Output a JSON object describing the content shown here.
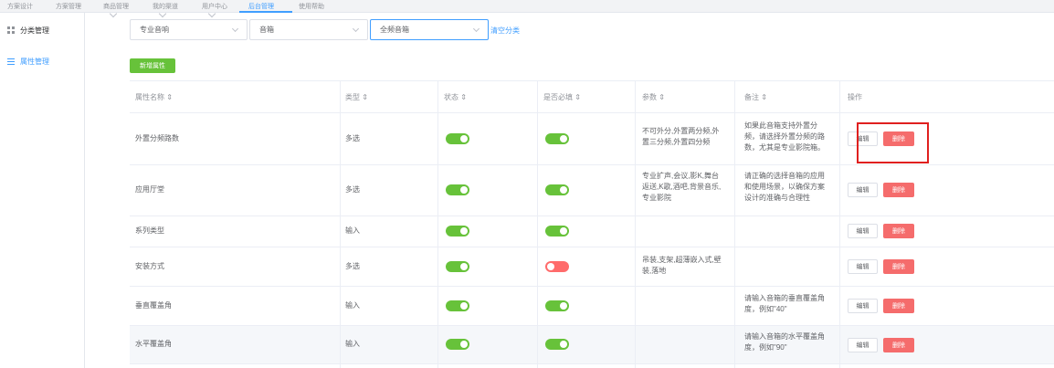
{
  "topnav": {
    "items": [
      "方案设计",
      "方案管理",
      "商品管理",
      "我的渠道",
      "用户中心",
      "后台管理",
      "使用帮助"
    ],
    "active_index": 5
  },
  "sidebar": {
    "items": [
      {
        "label": "分类管理",
        "icon": "grid-icon",
        "active": false
      },
      {
        "label": "属性管理",
        "icon": "list-icon",
        "active": true
      }
    ]
  },
  "filters": {
    "select1": "专业音响",
    "select2": "音箱",
    "select3": "全频音箱",
    "clear_label": "清空分类"
  },
  "add_button_label": "新增属性",
  "table": {
    "headers": [
      "属性名称 ⇕",
      "类型 ⇕",
      "状态 ⇕",
      "是否必填 ⇕",
      "参数 ⇕",
      "备注 ⇕",
      "操作"
    ],
    "rows": [
      {
        "name": "外置分频路数",
        "type": "多选",
        "status": true,
        "required": true,
        "params": [
          "不可外分,外置两分频,外",
          "置三分频,外置四分频"
        ],
        "note": [
          "如果此音箱支持外置分",
          "频，请选择外置分频的路",
          "数，尤其是专业影院箱。"
        ]
      },
      {
        "name": "应用厅堂",
        "type": "多选",
        "status": true,
        "required": true,
        "params": [
          "专业扩声,会议,影K,舞台",
          "返送,K歌,酒吧,背景音乐,",
          "专业影院"
        ],
        "note": [
          "请正确的选择音箱的应用",
          "和使用场景，以确保方案",
          "设计的准确与合理性"
        ]
      },
      {
        "name": "系列类型",
        "type": "输入",
        "status": true,
        "required": true,
        "params": [],
        "note": []
      },
      {
        "name": "安装方式",
        "type": "多选",
        "status": true,
        "required": false,
        "params": [
          "吊装,支架,超薄嵌入式,壁",
          "装,落地"
        ],
        "note": []
      },
      {
        "name": "垂直覆盖角",
        "type": "输入",
        "status": true,
        "required": true,
        "params": [],
        "note": [
          "请输入音箱的垂直覆盖角",
          "度，例如\"40\""
        ]
      },
      {
        "name": "水平覆盖角",
        "type": "输入",
        "status": true,
        "required": true,
        "params": [],
        "note": [
          "请输入音箱的水平覆盖角",
          "度，例如\"90\""
        ]
      }
    ],
    "edit_label": "编辑",
    "delete_label": "删除"
  },
  "colors": {
    "accent": "#409eff",
    "success": "#67c23a",
    "danger": "#f56c6c",
    "highlight_box": "#e0201f"
  }
}
